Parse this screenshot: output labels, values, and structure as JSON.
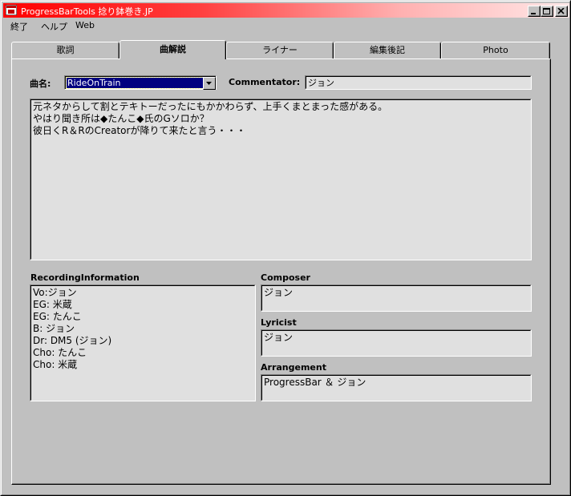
{
  "window": {
    "title": "ProgressBarTools  捻り鉢巻き.JP"
  },
  "menu": [
    "終了",
    "ヘルプ",
    "Web"
  ],
  "tabs": [
    {
      "label": "歌詞",
      "active": false
    },
    {
      "label": "曲解説",
      "active": true
    },
    {
      "label": "ライナー",
      "active": false
    },
    {
      "label": "編集後記",
      "active": false
    },
    {
      "label": "Photo",
      "active": false
    }
  ],
  "song": {
    "label": "曲名:",
    "selected": "RideOnTrain"
  },
  "commentator": {
    "label": "Commentator:",
    "value": "ジョン"
  },
  "commentary": "元ネタからして割とテキトーだったにもかかわらず、上手くまとまった感がある。\nやはり聞き所は◆たんこ◆氏のGソロか？\n彼日くR＆RのCreatorが降りて来たと言う・・・",
  "recording": {
    "label": "RecordingInformation",
    "value": "Vo:ジョン\nEG: 米蔵\nEG: たんこ\nB: ジョン\nDr: DM5 (ジョン)\nCho: たんこ\nCho: 米蔵"
  },
  "composer": {
    "label": "Composer",
    "value": "ジョン"
  },
  "lyricist": {
    "label": "Lyricist",
    "value": "ジョン"
  },
  "arrangement": {
    "label": "Arrangement",
    "value": "ProgressBar ＆ ジョン"
  }
}
